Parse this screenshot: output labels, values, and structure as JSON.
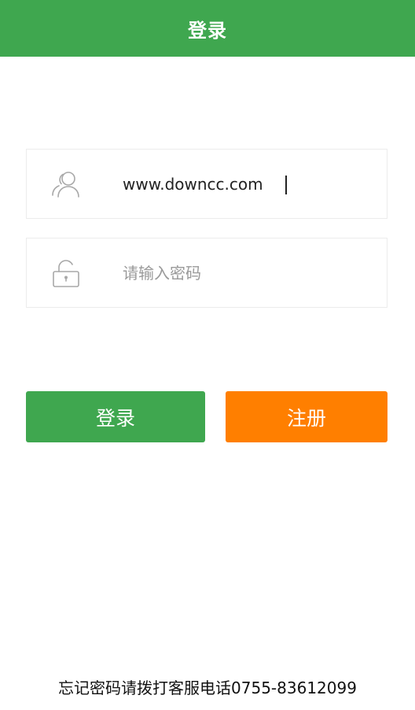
{
  "header": {
    "title": "登录"
  },
  "form": {
    "username": {
      "value": "www.downcc.com",
      "icon": "user-icon"
    },
    "password": {
      "value": "",
      "placeholder": "请输入密码",
      "icon": "lock-icon"
    }
  },
  "buttons": {
    "login_label": "登录",
    "register_label": "注册"
  },
  "footer": {
    "text": "忘记密码请拨打客服电话0755-83612099"
  },
  "colors": {
    "primary_green": "#3fa74f",
    "accent_orange": "#ff7f00"
  }
}
